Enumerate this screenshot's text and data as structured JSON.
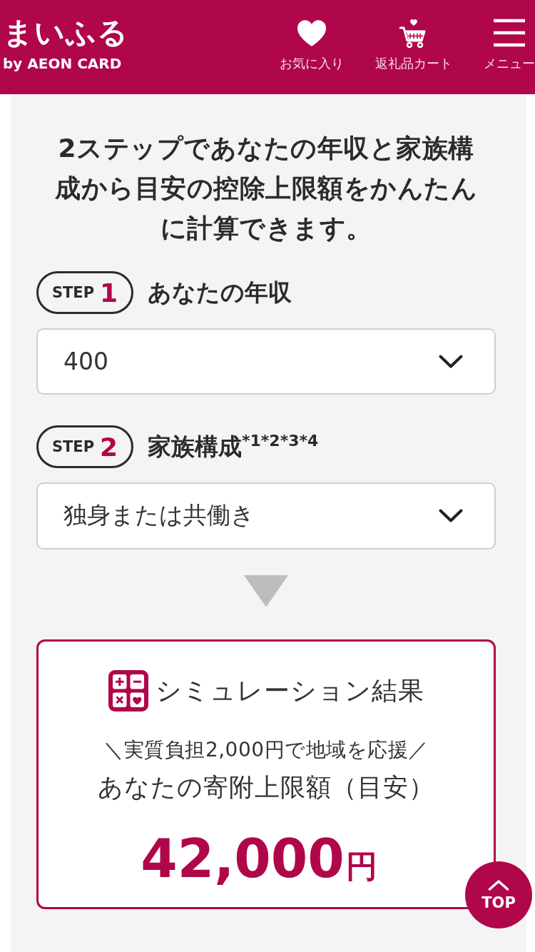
{
  "header": {
    "logo": "まいふる",
    "logo_sub": "by AEON CARD",
    "nav": [
      {
        "kind": "favorites",
        "label": "お気に入り"
      },
      {
        "kind": "cart",
        "label": "返礼品カート"
      },
      {
        "kind": "menu",
        "label": "メニュー"
      }
    ]
  },
  "intro": "2ステップであなたの年収と家族構成から目安の控除上限額をかんたんに計算できます。",
  "steps": [
    {
      "badge": "STEP",
      "number": "1",
      "label": "あなたの年収",
      "value": "400"
    },
    {
      "badge": "STEP",
      "number": "2",
      "label": "家族構成$^{*1*2*3*4}$",
      "value": "独身または共働き"
    }
  ],
  "result": {
    "title": "シミュレーション結果",
    "tagline": "＼実質負担2,000円で地域を応援／",
    "caption": "あなたの寄附上限額（目安）",
    "amount": "42,000",
    "unit": "円"
  },
  "top_button": {
    "label": "TOP"
  }
}
